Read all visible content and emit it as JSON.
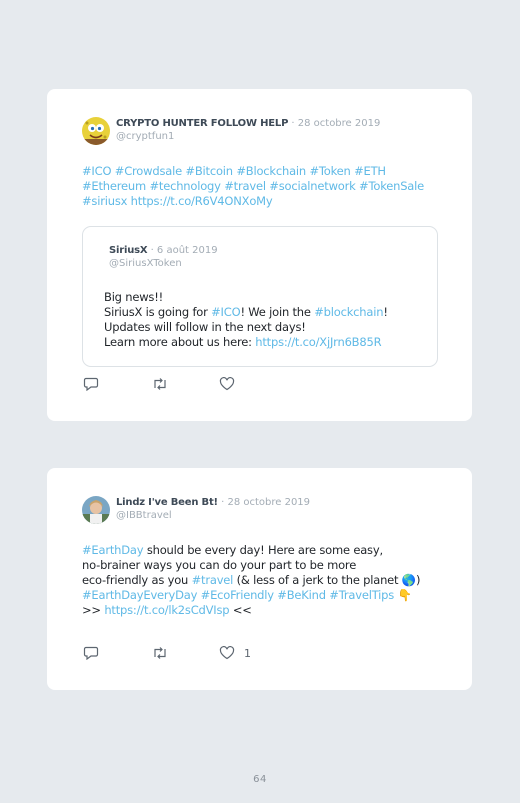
{
  "tweets": [
    {
      "author": "CRYPTO HUNTER FOLLOW HELP",
      "date": "28 octobre 2019",
      "handle": "@cryptfun1",
      "text_links": "#ICO #Crowdsale #Bitcoin #Blockchain #Token #ETH",
      "text_line2": "#Ethereum #technology #travel #socialnetwork #TokenSale",
      "text_line3": "#siriusx https://t.co/R6V4ONXoMy",
      "quoted": {
        "author": "SiriusX",
        "date": "6 août 2019",
        "handle": "@SiriusXToken",
        "line1": "Big news!!",
        "line2_a": "SiriusX is going for ",
        "line2_tag1": "#ICO",
        "line2_b": "! We join the ",
        "line2_tag2": "#blockchain",
        "line2_c": "!",
        "line3": "Updates will follow in the next days!",
        "line4_a": "Learn more about us here: ",
        "line4_link": "https://t.co/XjJrn6B85R"
      },
      "like_count": ""
    },
    {
      "author": "Lindz I've Been Bt!",
      "date": "28 octobre 2019",
      "handle": "@IBBtravel",
      "line1_tag": "#EarthDay",
      "line1_rest": " should be every day! Here are some easy,",
      "line2": "no-brainer ways you can do your part to be more",
      "line3_a": "eco-friendly as you ",
      "line3_tag": "#travel",
      "line3_b": " (& less of a jerk to the planet ",
      "line3_emoji": "🌎",
      "line3_c": ")",
      "line4_tags": "#EarthDayEveryDay #EcoFriendly #BeKind #TravelTips",
      "line4_emoji": "👇",
      "line5_a": ">> ",
      "line5_link": "https://t.co/lk2sCdVIsp",
      "line5_b": " <<",
      "like_count": "1"
    }
  ],
  "colors": {
    "link": "#5fb9e6",
    "background": "#e6eaee",
    "card": "#ffffff"
  },
  "icons": [
    "reply-icon",
    "retweet-icon",
    "like-icon"
  ],
  "page_number": "64"
}
